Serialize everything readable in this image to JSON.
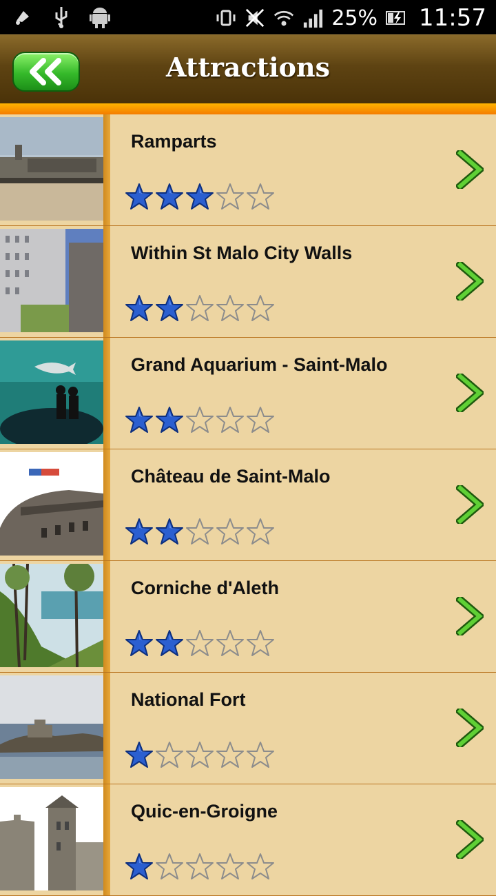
{
  "status_bar": {
    "icons_left": [
      "notification-icon",
      "usb-icon",
      "android-debug-icon"
    ],
    "icons_right": [
      "vibrate-icon",
      "mute-icon",
      "wifi-icon",
      "signal-icon"
    ],
    "battery_percent": "25%",
    "time": "11:57"
  },
  "header": {
    "back_icon": "double-chevron-left-icon",
    "title": "Attractions"
  },
  "attractions": [
    {
      "name": "Ramparts",
      "rating": 3,
      "max_rating": 5
    },
    {
      "name": "Within St Malo City Walls",
      "rating": 2,
      "max_rating": 5
    },
    {
      "name": "Grand Aquarium - Saint-Malo",
      "rating": 2,
      "max_rating": 5
    },
    {
      "name": "Château de Saint-Malo",
      "rating": 2,
      "max_rating": 5
    },
    {
      "name": "Corniche d'Aleth",
      "rating": 2,
      "max_rating": 5
    },
    {
      "name": "National Fort",
      "rating": 1,
      "max_rating": 5
    },
    {
      "name": "Quic-en-Groigne",
      "rating": 1,
      "max_rating": 5
    }
  ],
  "colors": {
    "accent_orange": "#f47c00",
    "list_background": "#edd5a2",
    "star_filled": "#2b5fd0",
    "chevron_green": "#3ab21f"
  }
}
